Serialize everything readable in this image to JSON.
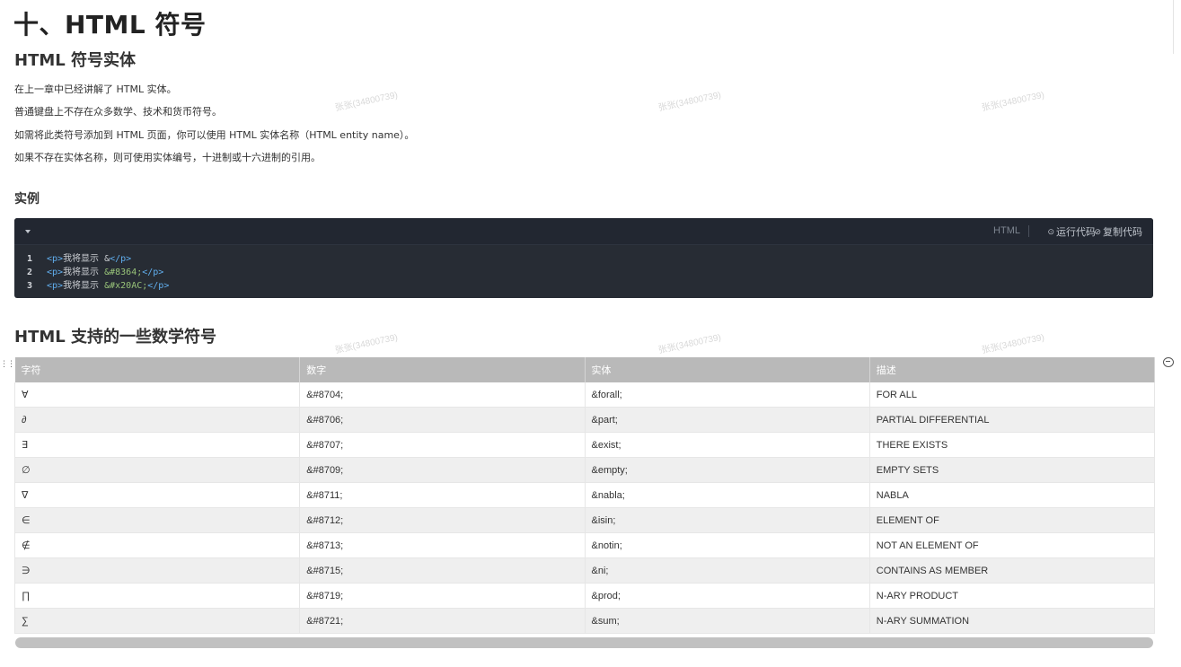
{
  "page": {
    "title": "十、HTML 符号",
    "section1_title": "HTML 符号实体",
    "paragraphs": [
      "在上一章中已经讲解了 HTML 实体。",
      "普通键盘上不存在众多数学、技术和货币符号。",
      "如需将此类符号添加到 HTML 页面，你可以使用 HTML 实体名称（HTML entity name）。",
      "如果不存在实体名称，则可使用实体编号，十进制或十六进制的引用。"
    ],
    "example_title": "实例",
    "section2_title": "HTML 支持的一些数学符号"
  },
  "watermark": "张张(34800739)",
  "code": {
    "language": "HTML",
    "run_label": "运行代码",
    "copy_label": "复制代码",
    "lines": [
      {
        "num": "1",
        "open": "<p>",
        "text": "我将显示 ",
        "entity": "&",
        "close": "</p>"
      },
      {
        "num": "2",
        "open": "<p>",
        "text": "我将显示 ",
        "entity": "&#8364;",
        "close": "</p>"
      },
      {
        "num": "3",
        "open": "<p>",
        "text": "我将显示 ",
        "entity": "&#x20AC;",
        "close": "</p>"
      }
    ]
  },
  "table": {
    "headers": [
      "字符",
      "数字",
      "实体",
      "描述"
    ],
    "rows": [
      [
        "∀",
        "&#8704;",
        "&forall;",
        "FOR ALL"
      ],
      [
        "∂",
        "&#8706;",
        "&part;",
        "PARTIAL DIFFERENTIAL"
      ],
      [
        "∃",
        "&#8707;",
        "&exist;",
        "THERE EXISTS"
      ],
      [
        "∅",
        "&#8709;",
        "&empty;",
        "EMPTY SETS"
      ],
      [
        "∇",
        "&#8711;",
        "&nabla;",
        "NABLA"
      ],
      [
        "∈",
        "&#8712;",
        "&isin;",
        "ELEMENT OF"
      ],
      [
        "∉",
        "&#8713;",
        "&notin;",
        "NOT AN ELEMENT OF"
      ],
      [
        "∋",
        "&#8715;",
        "&ni;",
        "CONTAINS AS MEMBER"
      ],
      [
        "∏",
        "&#8719;",
        "&prod;",
        "N-ARY PRODUCT"
      ],
      [
        "∑",
        "&#8721;",
        "&sum;",
        "N-ARY SUMMATION"
      ]
    ]
  },
  "colors": {
    "code_bg": "#272c34",
    "table_header_bg": "#b9b9b9",
    "row_alt_bg": "#efefef",
    "tag_color": "#61afef",
    "entity_color": "#98c379"
  },
  "icons": {
    "run": "play-circle-icon",
    "copy": "copy-link-icon",
    "toggle": "caret-down-icon",
    "comment": "comment-icon",
    "drag": "drag-handle-icon"
  }
}
